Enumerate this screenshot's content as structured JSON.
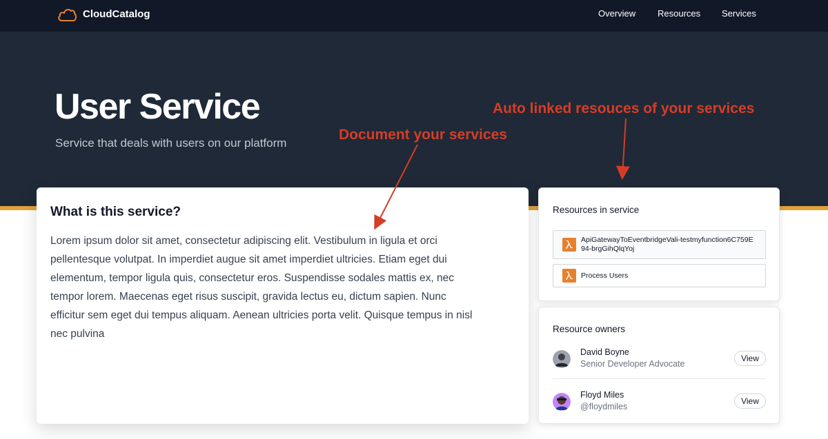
{
  "nav": {
    "brand": "CloudCatalog",
    "links": [
      "Overview",
      "Resources",
      "Services"
    ],
    "logo_icon": "cloud-icon",
    "logo_color": "#e8812d"
  },
  "hero": {
    "title": "User Service",
    "subtitle": "Service that deals with users on our platform"
  },
  "annotations": {
    "document": "Document your services",
    "resources": "Auto linked resouces of your services",
    "color": "#d63d27"
  },
  "main": {
    "heading": "What is this service?",
    "body": "Lorem ipsum dolor sit amet, consectetur adipiscing elit. Vestibulum in ligula et orci pellentesque volutpat. In imperdiet augue sit amet imperdiet ultricies. Etiam eget dui elementum, tempor ligula quis, consectetur eros. Suspendisse sodales mattis ex, nec tempor lorem. Maecenas eget risus suscipit, gravida lectus eu, dictum sapien. Nunc efficitur sem eget dui tempus aliquam. Aenean ultricies porta velit. Quisque tempus in nisl nec pulvina"
  },
  "resources": {
    "heading": "Resources in service",
    "items": [
      {
        "name": "ApiGatewayToEventbridgeVali-testmyfunction6C759E94-brgGihQlqYoj",
        "icon": "lambda-icon"
      },
      {
        "name": "Process Users",
        "icon": "lambda-icon"
      }
    ]
  },
  "owners": {
    "heading": "Resource owners",
    "items": [
      {
        "name": "David Boyne",
        "subtitle": "Senior Developer Advocate",
        "action": "View"
      },
      {
        "name": "Floyd Miles",
        "subtitle": "@floydmiles",
        "action": "View"
      }
    ]
  },
  "colors": {
    "nav_bg": "#111827",
    "hero_bg": "#1f2937",
    "accent_strip": "#e0a33a"
  }
}
